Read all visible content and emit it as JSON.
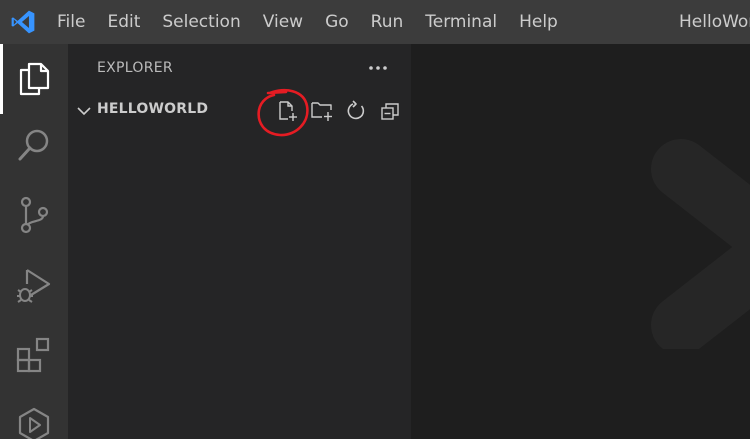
{
  "menu": {
    "items": [
      "File",
      "Edit",
      "Selection",
      "View",
      "Go",
      "Run",
      "Terminal",
      "Help"
    ]
  },
  "window": {
    "title": "HelloWorld"
  },
  "activity_bar": {
    "items": [
      {
        "icon": "files-icon",
        "active": true
      },
      {
        "icon": "search-icon",
        "active": false
      },
      {
        "icon": "source-control-icon",
        "active": false
      },
      {
        "icon": "run-debug-icon",
        "active": false
      },
      {
        "icon": "extensions-icon",
        "active": false
      },
      {
        "icon": "remote-explorer-icon",
        "active": false
      }
    ]
  },
  "sidebar": {
    "title": "EXPLORER",
    "more_label": "...",
    "section": {
      "title": "HELLOWORLD",
      "actions": [
        "new-file-icon",
        "new-folder-icon",
        "refresh-icon",
        "collapse-all-icon"
      ]
    }
  },
  "colors": {
    "titlebar": "#3c3c3c",
    "activity_bar": "#333333",
    "sidebar": "#252526",
    "editor": "#1e1e1e",
    "vscode_blue": "#3794ff",
    "annotation_red": "#e51c23"
  }
}
